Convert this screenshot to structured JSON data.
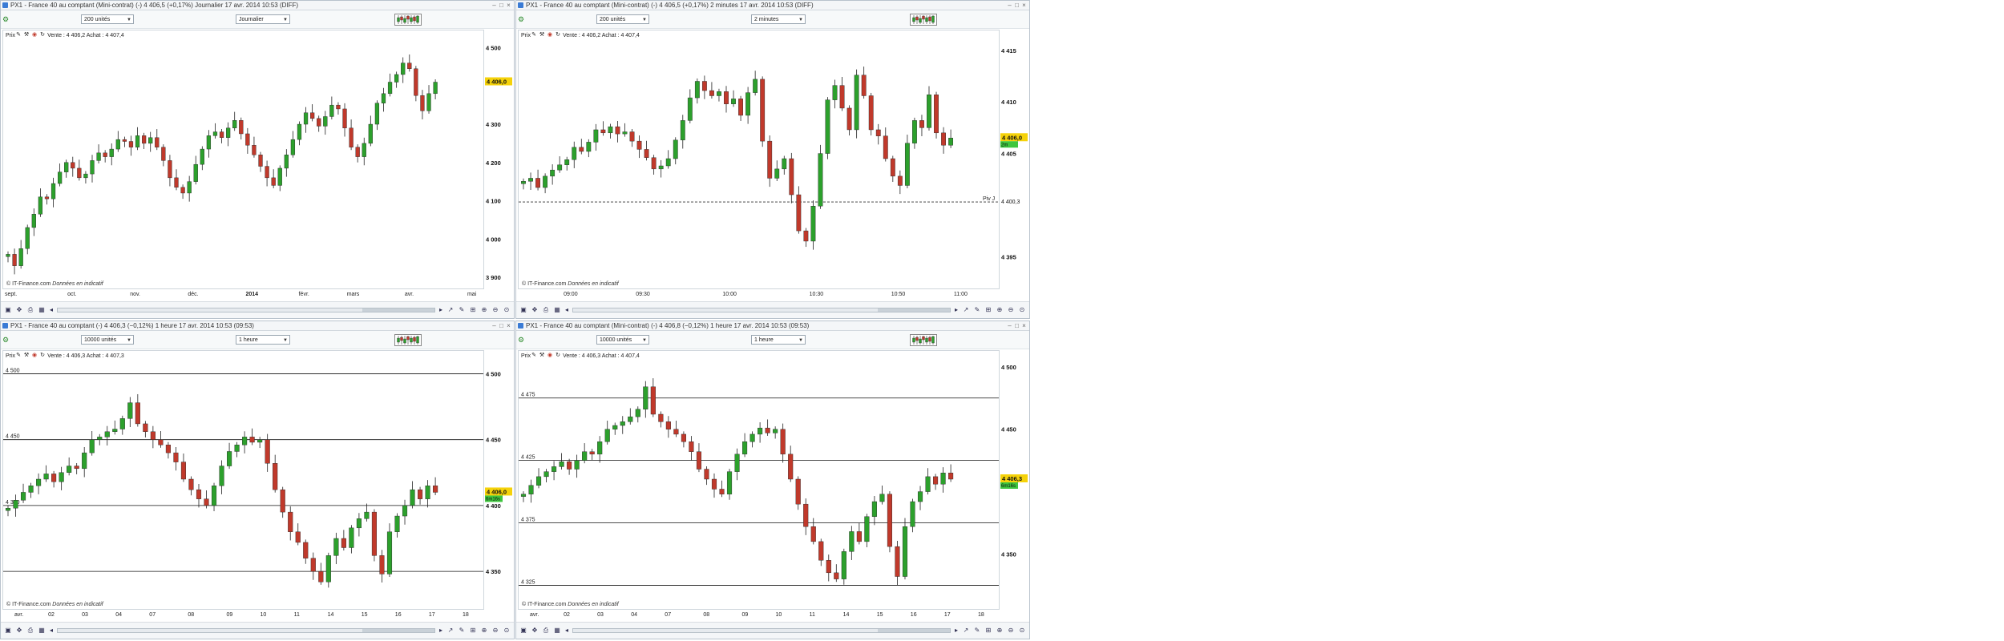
{
  "colors": {
    "up": "#2ca02c",
    "down": "#c0392b",
    "wick": "#222222",
    "badge_yellow": "#f5d20a",
    "badge_green": "#3ec63e",
    "line": "#111111"
  },
  "common": {
    "prix_label": "Prix",
    "credit_site": "© IT-Finance.com",
    "credit_note": "Données en indicatif"
  },
  "panels": [
    {
      "title": "PX1 - France 40 au comptant (Mini-contrat) (-)   4 406,5 (+0,17%)   Journalier   17 avr. 2014 10:53 (DIFF)",
      "units_label": "200 unités",
      "period_label": "Journalier",
      "quote": "Vente : 4 406,2  Achat : 4 407,4",
      "badge_price": "4 406,0",
      "badge_sub": "",
      "right_labels": [],
      "left_labels": []
    },
    {
      "title": "PX1 - France 40 au comptant (Mini-contrat) (-)   4 406,5 (+0,17%)   2 minutes   17 avr. 2014 10:53 (DIFF)",
      "units_label": "200 unités",
      "period_label": "2 minutes",
      "quote": "Vente : 4 406,2  Achat : 4 407,4",
      "badge_price": "4 406,0",
      "badge_sub": "2m",
      "pivot_label": "Piv J",
      "pivot_price": "4 400,3"
    },
    {
      "title": "PX1 - France 40 au comptant (-)   4 406,3 (−0,12%)   1 heure   17 avr. 2014 10:53 (09:53)",
      "units_label": "10000 unités",
      "period_label": "1 heure",
      "quote": "Vente : 4 406,3  Achat : 4 407,3",
      "badge_price": "4 406,0",
      "badge_sub": "6m16s",
      "left_labels": [
        "4 500",
        "4 450",
        "4 350"
      ]
    },
    {
      "title": "PX1 - France 40 au comptant (Mini-contrat) (-)   4 406,8 (−0,12%)   1 heure   17 avr. 2014 10:53 (09:53)",
      "units_label": "10000 unités",
      "period_label": "1 heure",
      "quote": "Vente : 4 406,3  Achat : 4 407,4",
      "badge_price": "4 406,3",
      "badge_sub": "6m16s",
      "left_labels": [
        "4 475",
        "4 425",
        "4 375",
        "4 325"
      ]
    }
  ],
  "chart_data": [
    {
      "type": "candlestick",
      "title": "",
      "xlabel": "",
      "ylabel": "",
      "ylim": [
        3900,
        4520
      ],
      "yticks": [
        {
          "value": 4500,
          "label": "4 500"
        },
        {
          "value": 4300,
          "label": "4 300"
        },
        {
          "value": 4200,
          "label": "4 200"
        },
        {
          "value": 4100,
          "label": "4 100"
        },
        {
          "value": 4000,
          "label": "4 000"
        },
        {
          "value": 3900,
          "label": "3 900"
        }
      ],
      "xticks": [
        "sept.",
        "oct.",
        "nov.",
        "déc.",
        "2014",
        "févr.",
        "mars",
        "avr.",
        "mai"
      ],
      "xtick_pos": [
        0.0,
        0.13,
        0.26,
        0.38,
        0.5,
        0.61,
        0.71,
        0.83,
        0.96
      ],
      "series": [
        {
          "name": "",
          "values": [
            3960,
            3930,
            3975,
            4030,
            4065,
            4110,
            4105,
            4145,
            4175,
            4200,
            4185,
            4160,
            4170,
            4205,
            4225,
            4215,
            4235,
            4260,
            4255,
            4240,
            4270,
            4250,
            4265,
            4240,
            4205,
            4160,
            4135,
            4120,
            4150,
            4195,
            4235,
            4270,
            4280,
            4265,
            4290,
            4310,
            4275,
            4245,
            4220,
            4190,
            4160,
            4140,
            4185,
            4220,
            4260,
            4300,
            4330,
            4315,
            4295,
            4320,
            4350,
            4340,
            4290,
            4240,
            4215,
            4250,
            4300,
            4355,
            4380,
            4410,
            4430,
            4460,
            4445,
            4375,
            4335,
            4380,
            4410
          ]
        }
      ],
      "grid": false
    },
    {
      "type": "candlestick",
      "title": "",
      "xlabel": "",
      "ylabel": "",
      "ylim": [
        4393,
        4416
      ],
      "yticks": [
        {
          "value": 4415,
          "label": "4 415"
        },
        {
          "value": 4410,
          "label": "4 410"
        },
        {
          "value": 4405,
          "label": "4 405"
        },
        {
          "value": 4400,
          "label": ""
        },
        {
          "value": 4395,
          "label": "4 395"
        }
      ],
      "xticks": [
        "09:00",
        "09:30",
        "10:00",
        "10:30",
        "10:50",
        "11:00"
      ],
      "xtick_pos": [
        0.09,
        0.24,
        0.42,
        0.6,
        0.77,
        0.9
      ],
      "pivot": 4400.3,
      "series": [
        {
          "name": "",
          "values": [
            4402.3,
            4402.6,
            4401.7,
            4402.8,
            4403.4,
            4403.9,
            4404.4,
            4405.6,
            4405.2,
            4406.1,
            4407.3,
            4407.0,
            4407.6,
            4406.9,
            4407.1,
            4406.2,
            4405.4,
            4404.6,
            4403.5,
            4403.8,
            4404.5,
            4406.3,
            4408.2,
            4410.4,
            4412.0,
            4411.1,
            4410.6,
            4411.0,
            4409.8,
            4410.3,
            4408.7,
            4410.9,
            4412.2,
            4406.2,
            4402.6,
            4403.5,
            4404.5,
            4401.0,
            4397.5,
            4396.5,
            4399.9,
            4405.0,
            4410.2,
            4411.6,
            4409.4,
            4407.3,
            4412.6,
            4410.6,
            4407.3,
            4406.7,
            4404.5,
            4402.8,
            4401.9,
            4406.0,
            4408.2,
            4407.5,
            4410.7,
            4407.0,
            4405.8,
            4406.5
          ]
        }
      ],
      "grid": false
    },
    {
      "type": "candlestick",
      "title": "",
      "xlabel": "",
      "ylabel": "",
      "ylim": [
        4330,
        4510
      ],
      "yticks": [
        {
          "value": 4500,
          "label": "4 500"
        },
        {
          "value": 4450,
          "label": "4 450"
        },
        {
          "value": 4400,
          "label": "4 400"
        },
        {
          "value": 4350,
          "label": "4 350"
        }
      ],
      "hlines": [
        4500,
        4450,
        4400,
        4350
      ],
      "xticks": [
        "avr.",
        "02",
        "03",
        "04",
        "07",
        "08",
        "09",
        "10",
        "11",
        "14",
        "15",
        "16",
        "17",
        "18"
      ],
      "xtick_pos": [
        0.02,
        0.09,
        0.16,
        0.23,
        0.3,
        0.38,
        0.46,
        0.53,
        0.6,
        0.67,
        0.74,
        0.81,
        0.88,
        0.95
      ],
      "series": [
        {
          "name": "",
          "values": [
            4398,
            4404,
            4410,
            4415,
            4420,
            4424,
            4418,
            4425,
            4430,
            4428,
            4440,
            4450,
            4452,
            4456,
            4458,
            4466,
            4478,
            4462,
            4456,
            4450,
            4446,
            4440,
            4433,
            4420,
            4412,
            4405,
            4400,
            4415,
            4430,
            4441,
            4446,
            4452,
            4448,
            4450,
            4432,
            4412,
            4395,
            4380,
            4372,
            4360,
            4350,
            4342,
            4362,
            4375,
            4368,
            4383,
            4390,
            4395,
            4362,
            4348,
            4380,
            4392,
            4400,
            4412,
            4405,
            4415,
            4410
          ]
        }
      ],
      "grid": false
    },
    {
      "type": "candlestick",
      "title": "",
      "xlabel": "",
      "ylabel": "",
      "ylim": [
        4315,
        4505
      ],
      "yticks": [
        {
          "value": 4500,
          "label": "4 500"
        },
        {
          "value": 4450,
          "label": "4 450"
        },
        {
          "value": 4400,
          "label": ""
        },
        {
          "value": 4350,
          "label": "4 350"
        }
      ],
      "hlines": [
        4475,
        4425,
        4375,
        4325
      ],
      "xticks": [
        "avr.",
        "02",
        "03",
        "04",
        "07",
        "08",
        "09",
        "10",
        "11",
        "14",
        "15",
        "16",
        "17",
        "18"
      ],
      "xtick_pos": [
        0.02,
        0.09,
        0.16,
        0.23,
        0.3,
        0.38,
        0.46,
        0.53,
        0.6,
        0.67,
        0.74,
        0.81,
        0.88,
        0.95
      ],
      "series": [
        {
          "name": "",
          "values": [
            4398,
            4405,
            4412,
            4416,
            4420,
            4424,
            4418,
            4425,
            4432,
            4430,
            4440,
            4450,
            4453,
            4456,
            4460,
            4466,
            4484,
            4462,
            4456,
            4450,
            4446,
            4440,
            4432,
            4418,
            4410,
            4402,
            4398,
            4416,
            4430,
            4440,
            4446,
            4451,
            4447,
            4450,
            4430,
            4410,
            4390,
            4372,
            4360,
            4345,
            4335,
            4330,
            4352,
            4368,
            4360,
            4380,
            4392,
            4398,
            4356,
            4332,
            4372,
            4392,
            4400,
            4412,
            4406,
            4415,
            4410
          ]
        }
      ],
      "grid": false
    }
  ]
}
